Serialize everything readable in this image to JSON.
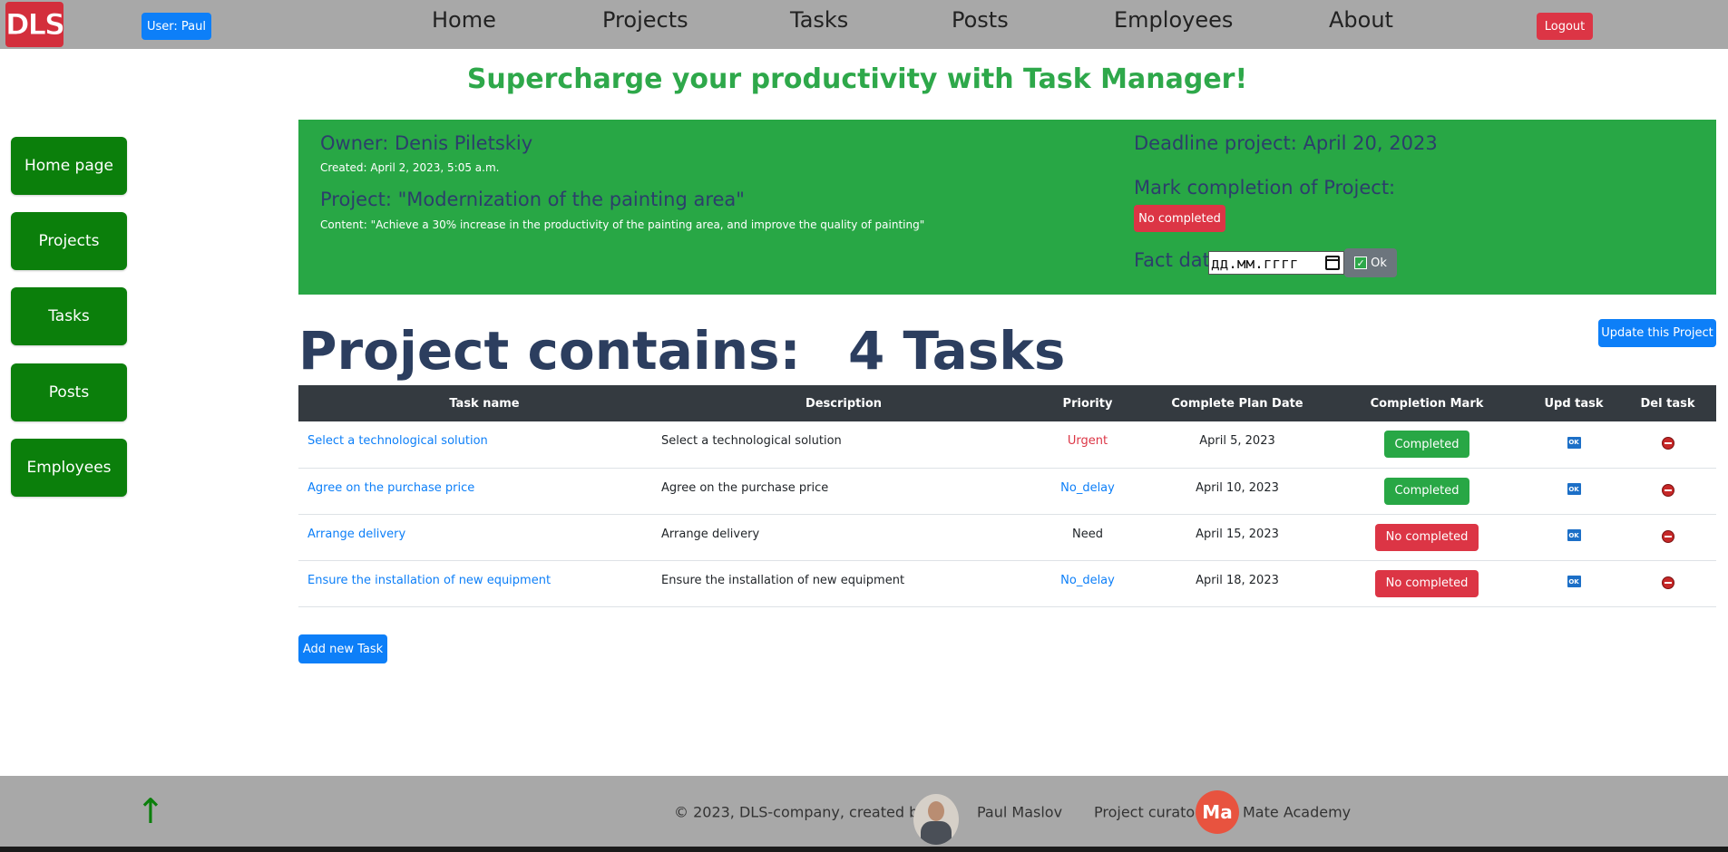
{
  "brand": {
    "logo_text": "DLS"
  },
  "header": {
    "user_label": "User: Paul",
    "logout_label": "Logout",
    "nav": [
      {
        "label": "Home"
      },
      {
        "label": "Projects"
      },
      {
        "label": "Tasks"
      },
      {
        "label": "Posts"
      },
      {
        "label": "Employees"
      },
      {
        "label": "About"
      }
    ]
  },
  "headline": "Supercharge your productivity with Task Manager!",
  "sidebar": {
    "items": [
      {
        "label": "Home page"
      },
      {
        "label": "Projects"
      },
      {
        "label": "Tasks"
      },
      {
        "label": "Posts"
      },
      {
        "label": "Employees"
      }
    ]
  },
  "project": {
    "owner": "Owner: Denis Piletskiy",
    "created": "Created: April 2, 2023, 5:05 a.m.",
    "title": "Project: \"Modernization of the painting area\"",
    "content": "Content: \"Achieve a 30% increase in the productivity of the painting area, and improve the quality of painting\"",
    "deadline": "Deadline project: April 20, 2023",
    "mark_label": "Mark completion of Project:",
    "mark_status": "No completed",
    "fact_date_label": "Fact date:",
    "fact_date_placeholder": "дд.мм.гггг",
    "ok_label": "Ok"
  },
  "summary": {
    "contains_label": "Project contains:",
    "tasks_count": "4 Tasks",
    "update_label": "Update this Project"
  },
  "table": {
    "headers": [
      "Task name",
      "Description",
      "Priority",
      "Complete Plan Date",
      "Completion Mark",
      "Upd task",
      "Del task"
    ],
    "rows": [
      {
        "name": "Select a technological solution",
        "description": "Select a technological solution",
        "priority": "Urgent",
        "plan_date": "April 5, 2023",
        "mark": "Completed"
      },
      {
        "name": "Agree on the purchase price",
        "description": "Agree on the purchase price",
        "priority": "No_delay",
        "plan_date": "April 10, 2023",
        "mark": "Completed"
      },
      {
        "name": "Arrange delivery",
        "description": "Arrange delivery",
        "priority": "Need",
        "plan_date": "April 15, 2023",
        "mark": "No completed"
      },
      {
        "name": "Ensure the installation of new equipment",
        "description": "Ensure the installation of new equipment",
        "priority": "No_delay",
        "plan_date": "April 18, 2023",
        "mark": "No completed"
      }
    ],
    "upd_icon_text": "OK"
  },
  "add_task_label": "Add new Task",
  "footer": {
    "up_arrow": "↑",
    "copyright": "© 2023, DLS-company, created by",
    "author": "Paul Maslov",
    "curator_label": "Project curator:",
    "curator_logo": "Ma",
    "curator": "Mate Academy"
  },
  "colors": {
    "accent_green": "#28a745",
    "sidebar_green": "#0b7f0b",
    "primary_blue": "#0d7ff8",
    "danger_red": "#dc3545",
    "nav_gray": "#a8a8a8",
    "table_header": "#343a40",
    "heading_navy": "#2c3e5f"
  },
  "icons": {
    "logo": "dls-logo",
    "calendar": "calendar-icon",
    "check": "checkbox-check-icon",
    "update": "ok-edit-icon",
    "delete": "delete-minus-icon",
    "up": "up-arrow-icon"
  }
}
